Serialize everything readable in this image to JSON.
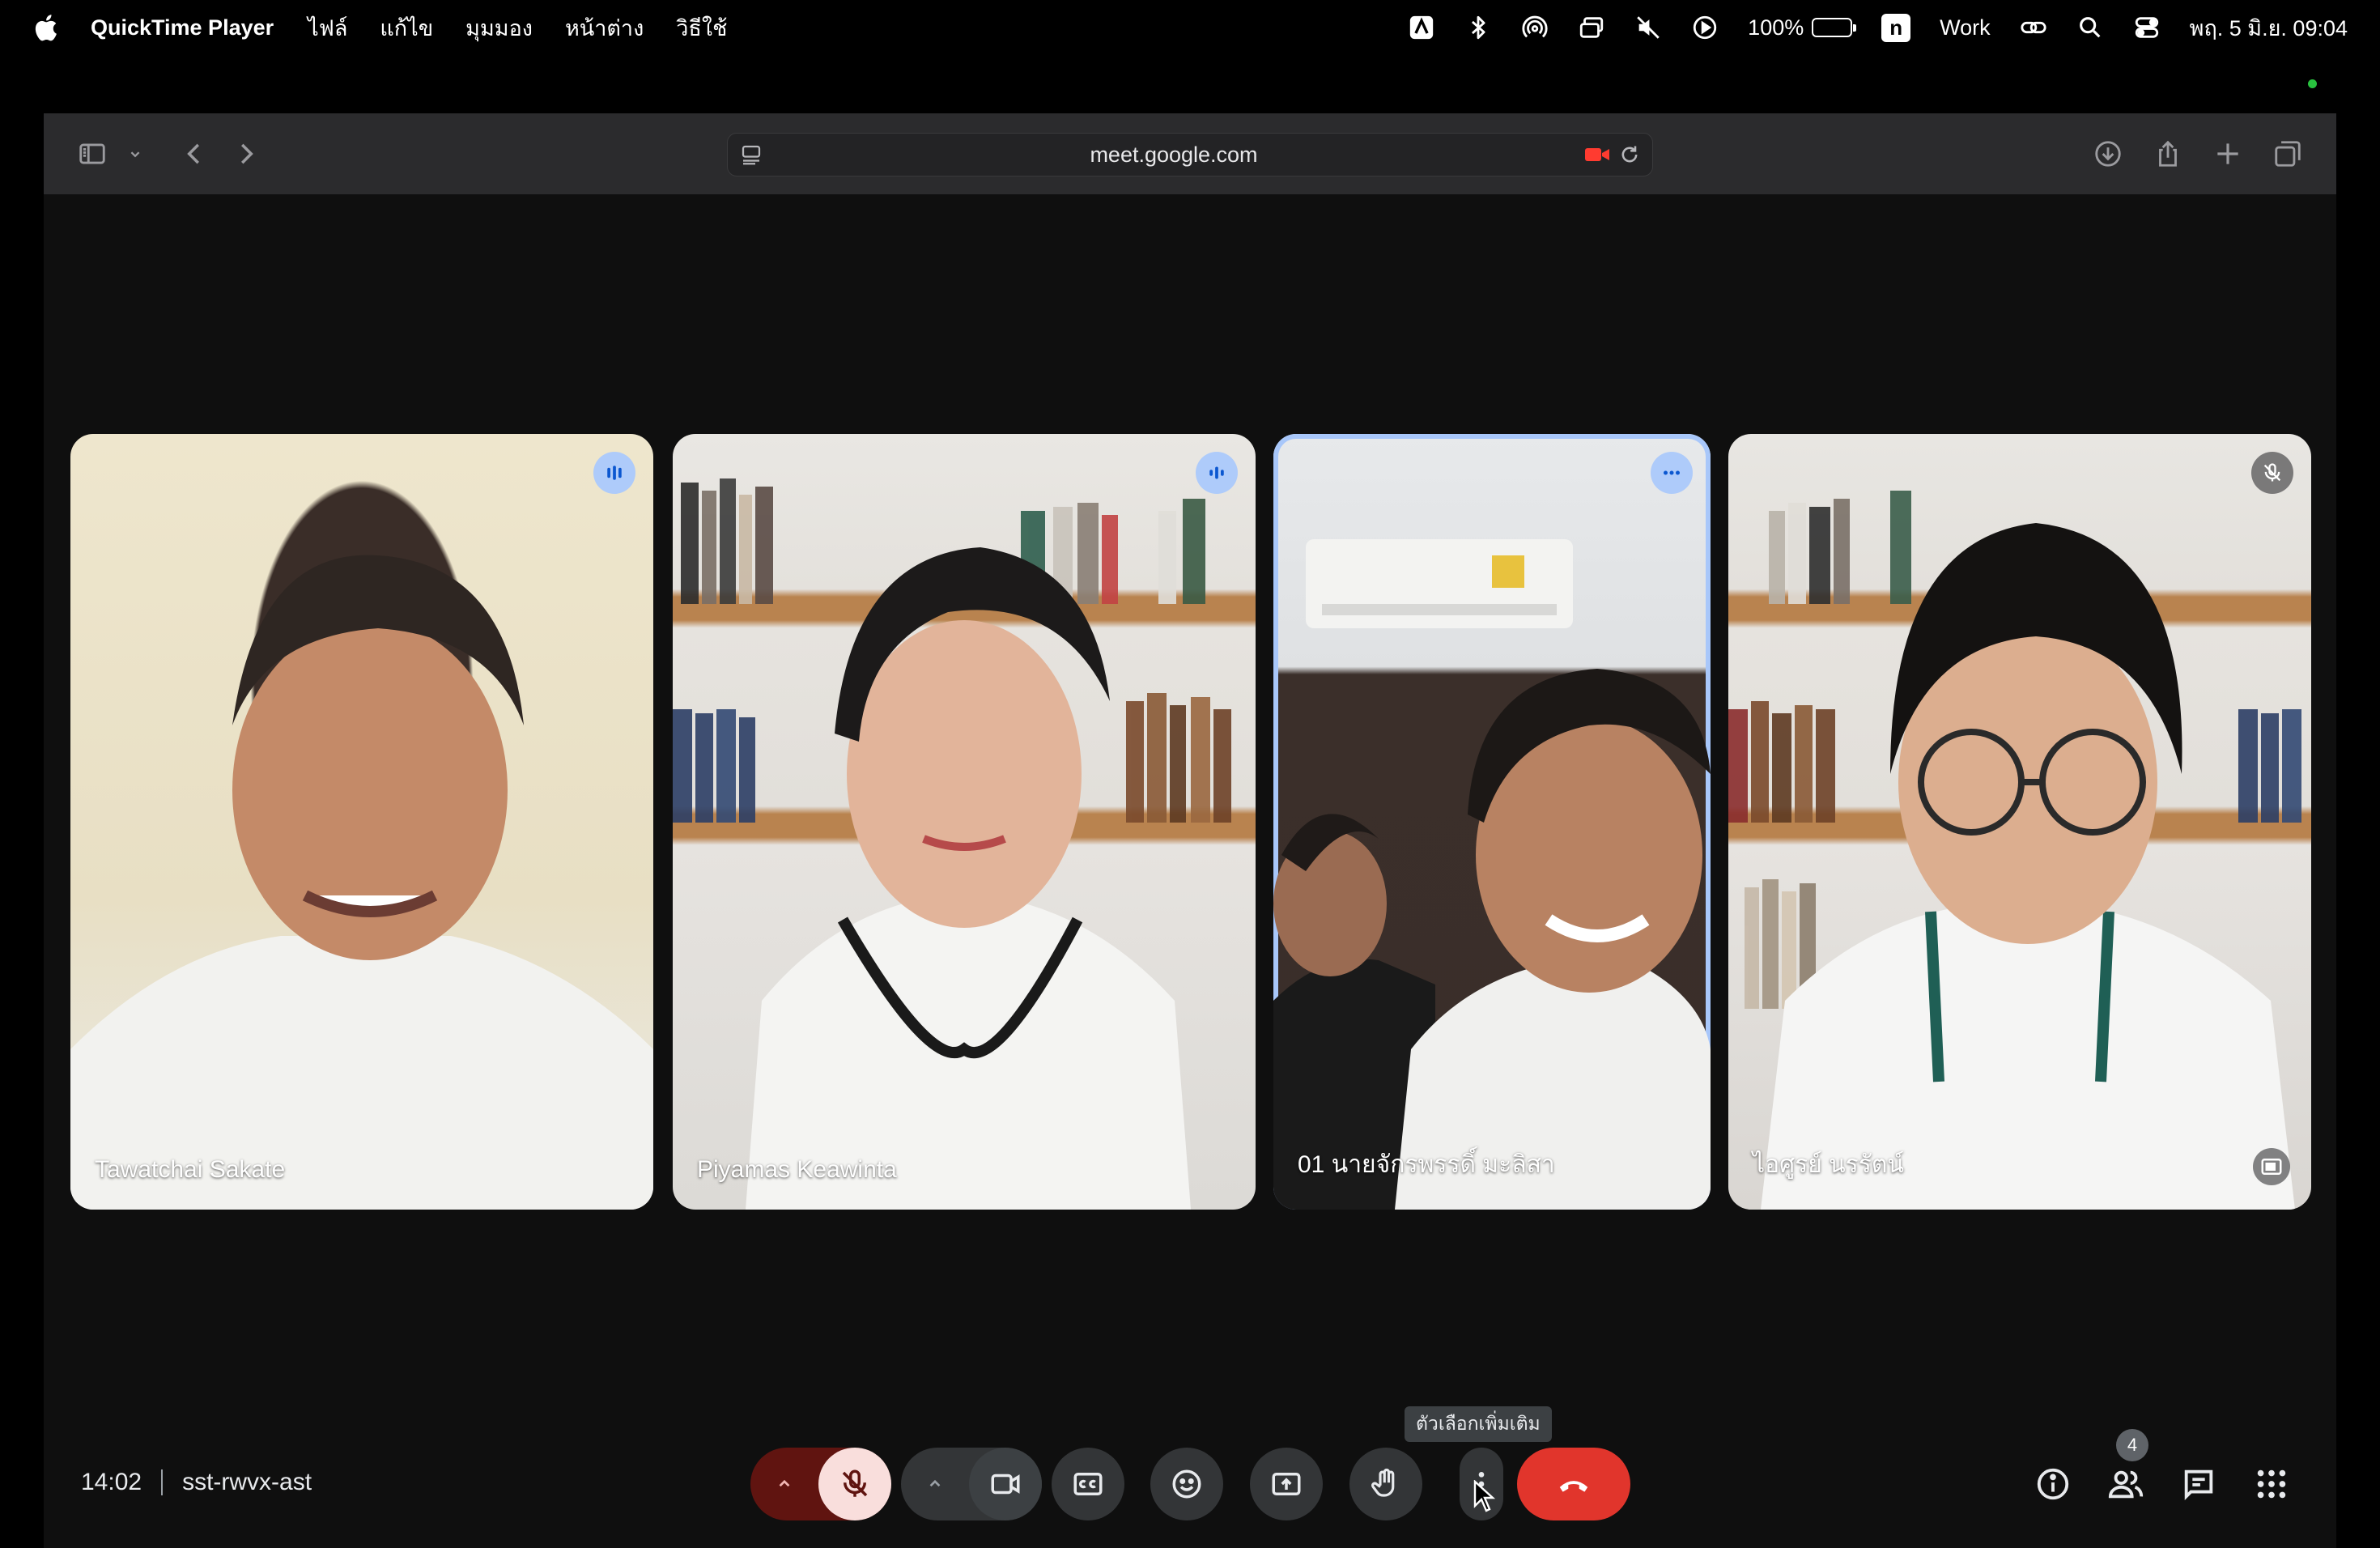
{
  "menubar": {
    "app_name": "QuickTime Player",
    "menus": [
      "ไฟล์",
      "แก้ไข",
      "มุมมอง",
      "หน้าต่าง",
      "วิธีใช้"
    ],
    "battery_percent": "100%",
    "battery_level": 1.0,
    "input_badge": "n",
    "focus_label": "Work",
    "datetime": "พฤ. 5 มิ.ย. 09:04"
  },
  "browser": {
    "url": "meet.google.com"
  },
  "meet": {
    "participants": [
      {
        "name": "Tawatchai Sakate",
        "status": "speaking"
      },
      {
        "name": "Piyamas Keawinta",
        "status": "speaking"
      },
      {
        "name": "01 นายจักรพรรดิ์ มะลิสา",
        "status": "more-options"
      },
      {
        "name": "ไอศูรย์ นรรัตน์",
        "status": "muted"
      }
    ],
    "time": "14:02",
    "meeting_code": "sst-rwvx-ast",
    "tooltip": "ตัวเลือกเพิ่มเติม",
    "people_count": "4",
    "colors": {
      "end_call": "#e1352c",
      "mic_off_bg": "#f9dedc",
      "mic_group_bg": "#601410",
      "active_border": "#a8c7fa"
    }
  }
}
